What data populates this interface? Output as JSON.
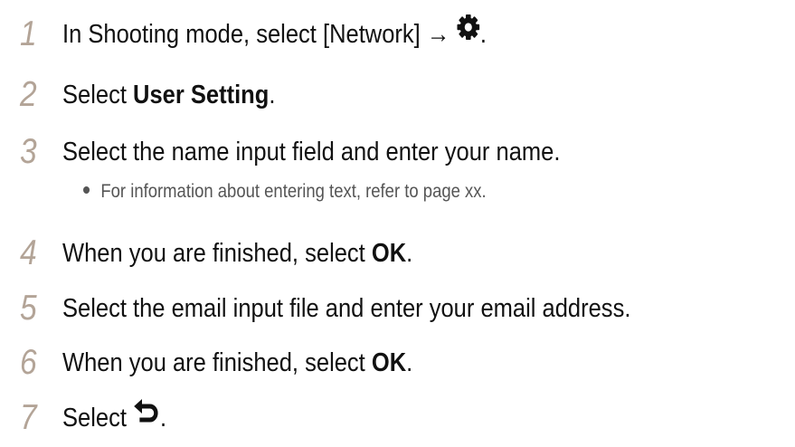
{
  "steps": [
    {
      "number": "1",
      "parts": [
        "In Shooting mode, select [Network] → ",
        "."
      ],
      "icon": "gear-icon"
    },
    {
      "number": "2",
      "text_before": "Select ",
      "bold": "User Setting",
      "text_after": "."
    },
    {
      "number": "3",
      "text": "Select the name input field and enter your name.",
      "sub_bullet": "For information about entering text, refer to page xx."
    },
    {
      "number": "4",
      "text_before": "When you are finished, select ",
      "bold": "OK",
      "text_after": "."
    },
    {
      "number": "5",
      "text": "Select the email input file and enter your email address."
    },
    {
      "number": "6",
      "text_before": "When you are finished, select ",
      "bold": "OK",
      "text_after": "."
    },
    {
      "number": "7",
      "parts": [
        "Select ",
        "."
      ],
      "icon": "back-arrow-icon"
    }
  ],
  "colors": {
    "step_number": "#b3a497",
    "text": "#111111",
    "sub_text": "#555555"
  }
}
